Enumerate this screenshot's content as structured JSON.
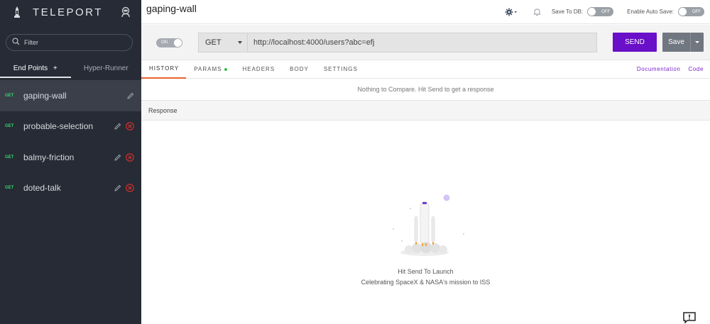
{
  "sidebar": {
    "app_title": "TELEPORT",
    "filter_placeholder": "Filter",
    "tabs": [
      {
        "label": "End Points",
        "plus": "+"
      },
      {
        "label": "Hyper-Runner"
      }
    ],
    "items": [
      {
        "method": "GET",
        "name": "gaping-wall"
      },
      {
        "method": "GET",
        "name": "probable-selection"
      },
      {
        "method": "GET",
        "name": "balmy-friction"
      },
      {
        "method": "GET",
        "name": "doted-talk"
      }
    ]
  },
  "topbar": {
    "title": "gaping-wall",
    "save_to_db_label": "Save To DB:",
    "save_to_db_state": "OFF",
    "auto_save_label": "Enable Auto Save:",
    "auto_save_state": "OFF"
  },
  "request": {
    "toggle_state": "ON",
    "method": "GET",
    "url": "http://localhost:4000/users?abc=efj",
    "send_label": "SEND",
    "save_label": "Save"
  },
  "tabs": {
    "items": [
      "HISTORY",
      "PARAMS",
      "HEADERS",
      "BODY",
      "SETTINGS"
    ],
    "links": [
      "Documentation",
      "Code"
    ]
  },
  "compare_message": "Nothing to Compare. Hit Send to get a response",
  "response_header": "Response",
  "empty_state": {
    "title": "Hit Send To Launch",
    "subtitle": "Celebrating SpaceX & NASA's mission to ISS"
  },
  "colors": {
    "sidebar_bg": "#262b35",
    "accent_purple": "#6a10c8",
    "active_tab_orange": "#e8632c",
    "method_green": "#3bd16f",
    "delete_red": "#e0302c"
  }
}
